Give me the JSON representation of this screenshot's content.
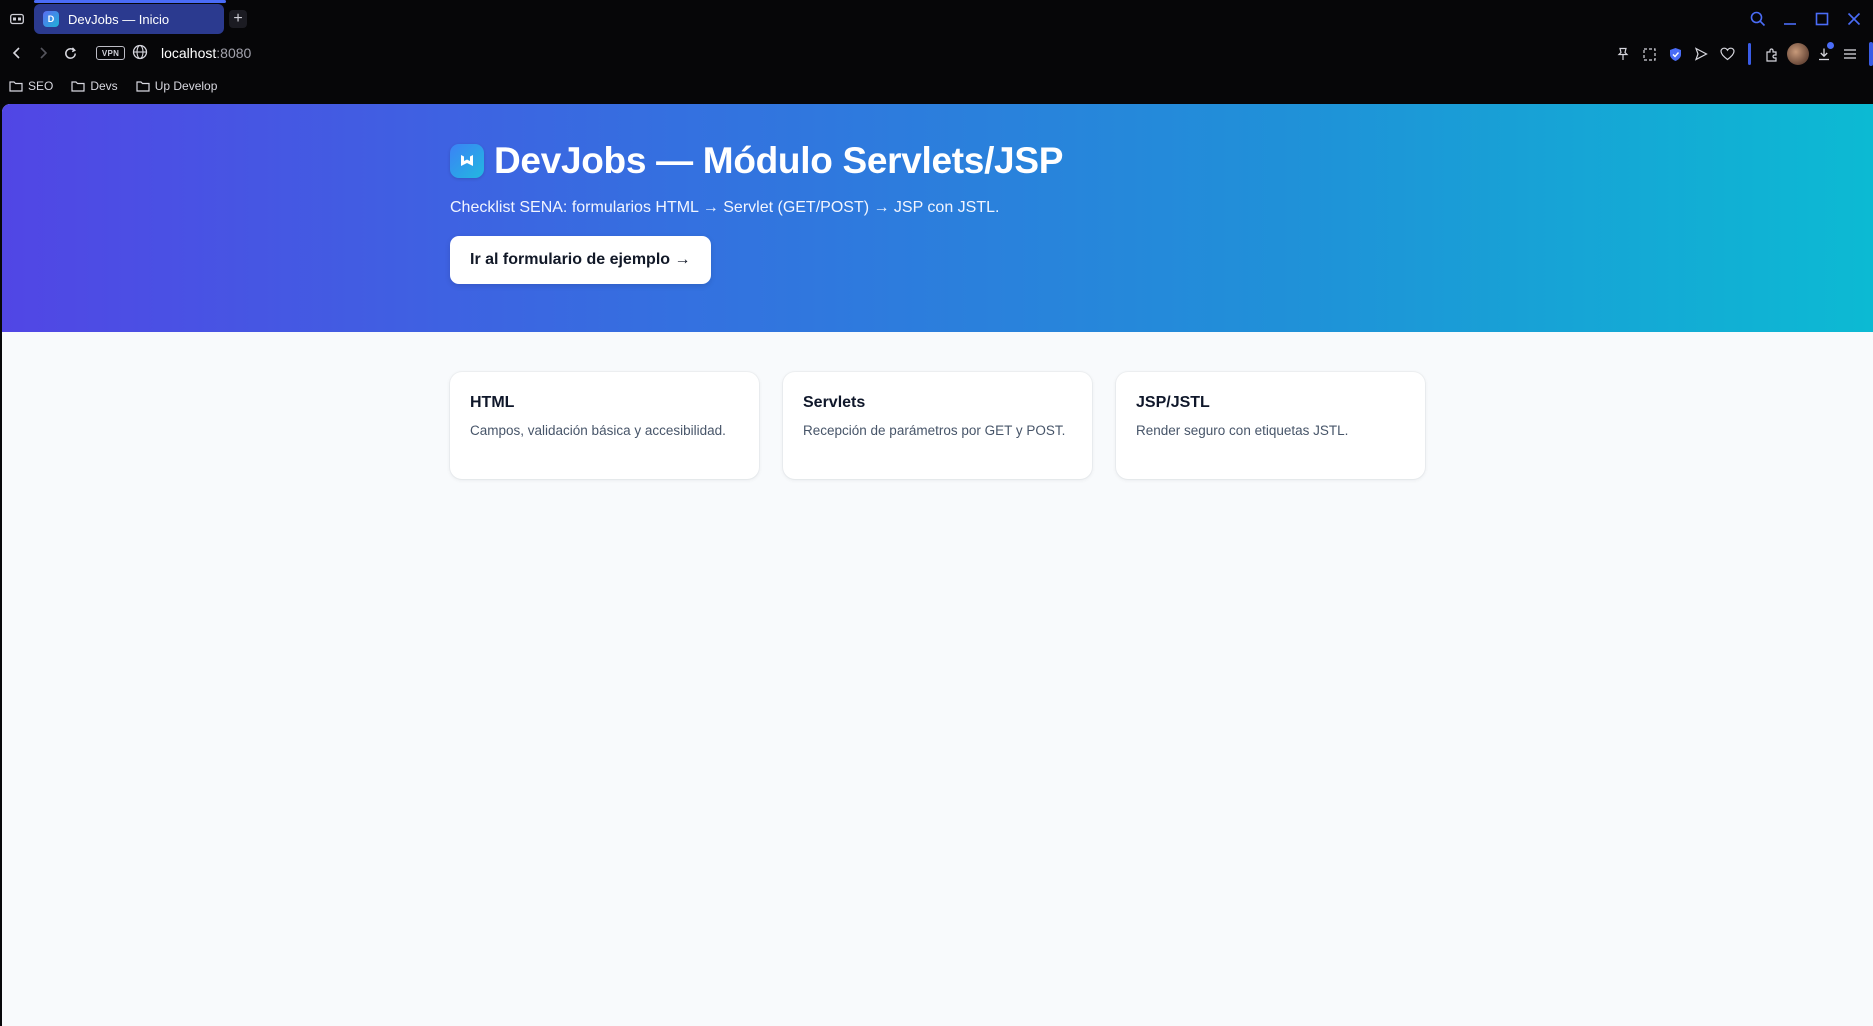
{
  "browser": {
    "tab": {
      "title": "DevJobs — Inicio",
      "favicon_letter": "D"
    },
    "new_tab_label": "+",
    "url": {
      "host": "localhost",
      "port": ":8080"
    },
    "vpn_label": "VPN",
    "bookmarks": [
      {
        "label": "SEO",
        "icon": "folder-icon"
      },
      {
        "label": "Devs",
        "icon": "folder-icon"
      },
      {
        "label": "Up Develop",
        "icon": "folder-icon"
      }
    ],
    "toolbar_icons": [
      "pin-icon",
      "snapshot-icon",
      "shield-icon",
      "send-icon",
      "heart-icon",
      "extensions-icon",
      "avatar",
      "download-icon",
      "menu-icon"
    ],
    "accent_color": "#4a6cf7"
  },
  "hero": {
    "title": "DevJobs — Módulo Servlets/JSP",
    "subtitle": "Checklist SENA: formularios HTML → Servlet (GET/POST) → JSP con JSTL.",
    "cta_label": "Ir al formulario de ejemplo →",
    "gradient_start": "#5146e5",
    "gradient_end": "#0cbad3"
  },
  "cards": [
    {
      "title": "HTML",
      "description": "Campos, validación básica y accesibilidad."
    },
    {
      "title": "Servlets",
      "description": "Recepción de parámetros por GET y POST."
    },
    {
      "title": "JSP/JSTL",
      "description": "Render seguro con etiquetas JSTL."
    }
  ]
}
